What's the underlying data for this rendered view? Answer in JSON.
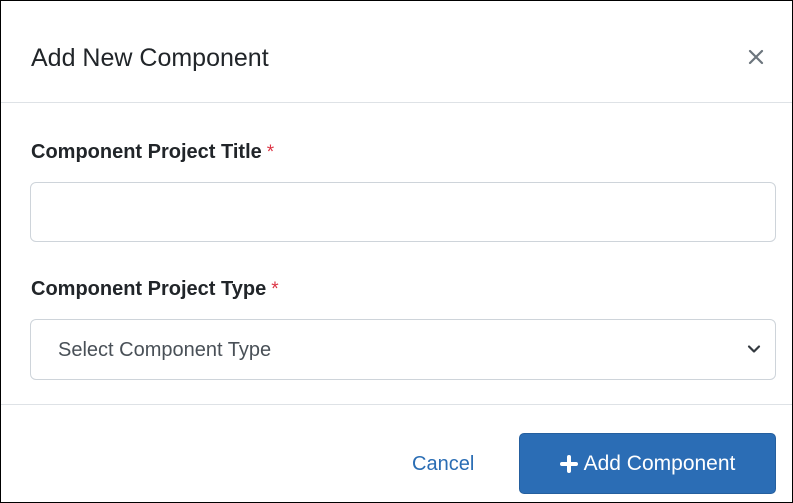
{
  "dialog": {
    "title": "Add New Component",
    "close_icon": "close-icon"
  },
  "form": {
    "title_field": {
      "label": "Component Project Title",
      "required_marker": "*",
      "value": "",
      "placeholder": ""
    },
    "type_field": {
      "label": "Component Project Type",
      "required_marker": "*",
      "selected_value": "Select Component Type",
      "chevron_icon": "chevron-down-icon"
    }
  },
  "footer": {
    "cancel_label": "Cancel",
    "add_label": "Add Component",
    "add_icon": "plus-icon"
  },
  "colors": {
    "primary": "#2b6db5",
    "link": "#2a6db4",
    "required": "#dc3545",
    "border": "#ced4da",
    "divider": "#dee2e6"
  }
}
